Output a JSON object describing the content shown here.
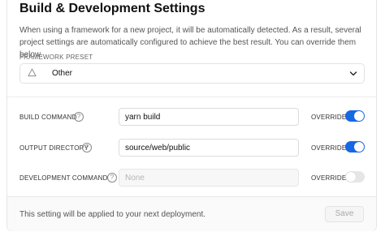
{
  "header": {
    "title": "Build & Development Settings",
    "description": "When using a framework for a new project, it will be automatically detected. As a result, several project settings are automatically configured to achieve the best result. You can override them below."
  },
  "framework_preset": {
    "label": "FRAMEWORK PRESET",
    "value": "Other",
    "icon": "warning-triangle-icon"
  },
  "settings": [
    {
      "label": "BUILD COMMAND",
      "value": "yarn build",
      "placeholder": "",
      "override_label": "OVERRIDE",
      "override": true,
      "disabled": false
    },
    {
      "label": "OUTPUT DIRECTORY",
      "value": "source/web/public",
      "placeholder": "",
      "override_label": "OVERRIDE",
      "override": true,
      "disabled": false
    },
    {
      "label": "DEVELOPMENT COMMAND",
      "value": "",
      "placeholder": "None",
      "override_label": "OVERRIDE",
      "override": false,
      "disabled": true
    }
  ],
  "help_glyph": "?",
  "footer": {
    "note": "This setting will be applied to your next deployment.",
    "save_label": "Save"
  },
  "colors": {
    "toggle_on": "#1668e3",
    "toggle_off": "#e6e6e6"
  }
}
